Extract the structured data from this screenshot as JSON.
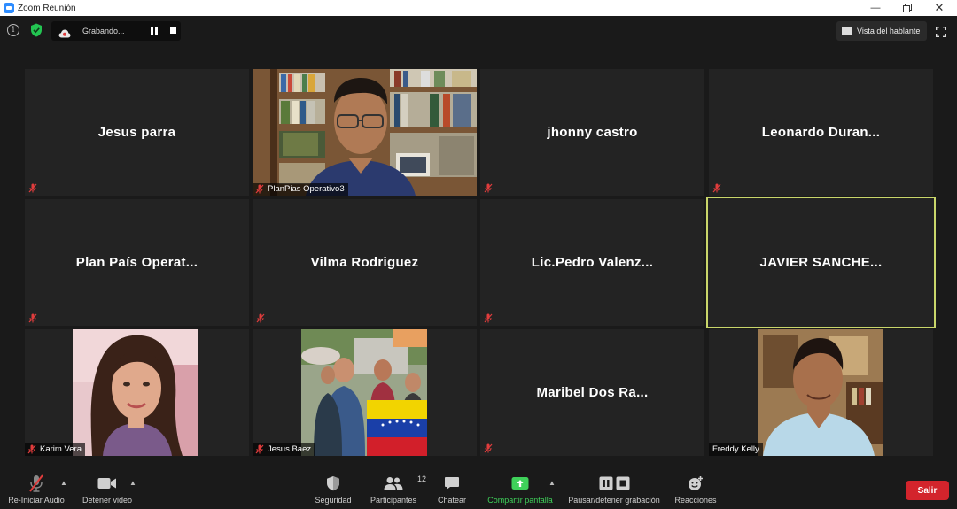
{
  "window": {
    "title": "Zoom Reunión"
  },
  "top_bar": {
    "recording_label": "Grabando...",
    "view_button_label": "Vista del hablante"
  },
  "tiles": [
    {
      "name": "Jesus parra",
      "video": false
    },
    {
      "name": "PlanPias Operativo3",
      "video": true
    },
    {
      "name": "jhonny castro",
      "video": false
    },
    {
      "name": "Leonardo  Duran...",
      "video": false
    },
    {
      "name": "Plan País Operat...",
      "video": false
    },
    {
      "name": "Vilma Rodriguez",
      "video": false
    },
    {
      "name": "Lic.Pedro  Valenz...",
      "video": false
    },
    {
      "name": "JAVIER  SANCHE...",
      "video": false,
      "active_speaker": true
    },
    {
      "name": "Karim Vera",
      "video": true
    },
    {
      "name": "Jesus Baez",
      "video": true
    },
    {
      "name": "Maribel Dos Ra...",
      "video": false
    },
    {
      "name": "Freddy Kelly",
      "video": true
    }
  ],
  "toolbar": {
    "audio_label": "Re-Iniciar Audio",
    "video_label": "Detener video",
    "security_label": "Seguridad",
    "participants_label": "Participantes",
    "participants_count": "12",
    "chat_label": "Chatear",
    "share_label": "Compartir pantalla",
    "record_label": "Pausar/detener grabación",
    "reactions_label": "Reacciones",
    "leave_label": "Salir"
  },
  "colors": {
    "active_border": "#c9d66a",
    "share_green": "#3fd15a",
    "leave_red": "#d3242c",
    "muted_mic": "#e03c3c"
  }
}
